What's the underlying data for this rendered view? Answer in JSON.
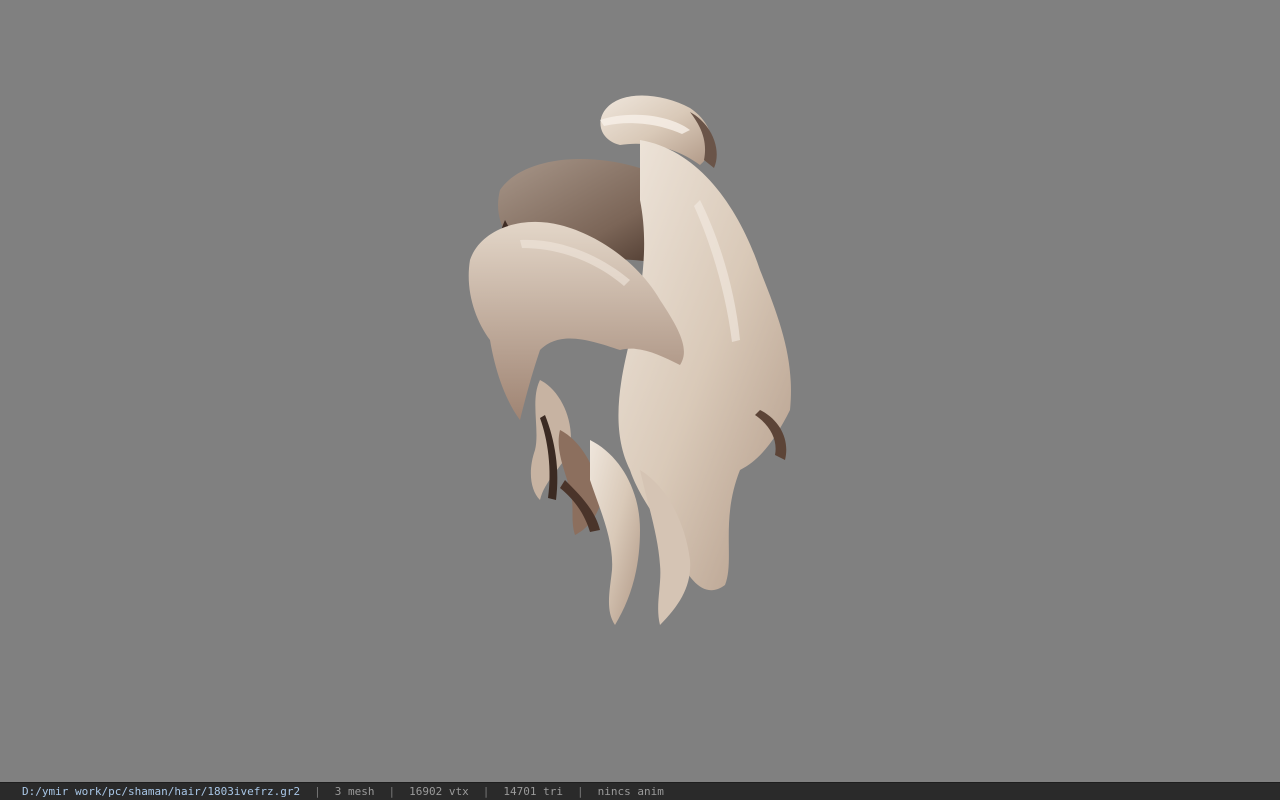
{
  "viewport": {
    "background_color": "#808080",
    "model_icon": "hair-mesh-icon"
  },
  "statusbar": {
    "file_path": "D:/ymir work/pc/shaman/hair/1803ivefrz.gr2",
    "separator": "|",
    "mesh_count": "3 mesh",
    "vertex_count": "16902 vtx",
    "triangle_count": "14701 tri",
    "animation": "nincs anim"
  }
}
